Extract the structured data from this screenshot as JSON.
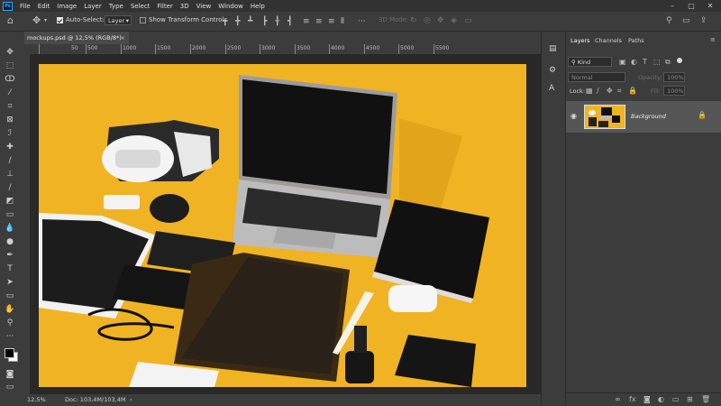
{
  "app": {
    "logo": "Ps"
  },
  "menu": [
    "File",
    "Edit",
    "Image",
    "Layer",
    "Type",
    "Select",
    "Filter",
    "3D",
    "View",
    "Window",
    "Help"
  ],
  "options_bar": {
    "auto_select_label": "Auto-Select:",
    "auto_select_checked": true,
    "auto_select_target": "Layer",
    "transform_controls_label": "Show Transform Controls",
    "transform_controls_checked": false,
    "mode_3d_label": "3D Mode:"
  },
  "document_tab": {
    "title": "mockups.psd @ 12,5% (RGB/8*)",
    "close": "×"
  },
  "ruler": {
    "top_labels": [
      "50",
      "500",
      "1000",
      "1500",
      "2000",
      "2500",
      "3000",
      "3500",
      "4000",
      "4500",
      "5000",
      "5500"
    ]
  },
  "status": {
    "zoom": "12,5%",
    "doc_info": "Doc: 103,4M/103,4M",
    "arrow": "›"
  },
  "panels": {
    "tabs": [
      "Layers",
      "Channels",
      "Paths"
    ],
    "active_tab": "Layers",
    "filter_placeholder": "Kind",
    "blend_mode": "Normal",
    "opacity_label": "Opacity:",
    "opacity_value": "100%",
    "lock_label": "Lock:",
    "fill_label": "Fill:",
    "fill_value": "100%",
    "layers": [
      {
        "name": "Background",
        "visible": true,
        "locked": true
      }
    ]
  },
  "colors": {
    "artboard": "#f0b323",
    "accent": "#31a8ff"
  }
}
